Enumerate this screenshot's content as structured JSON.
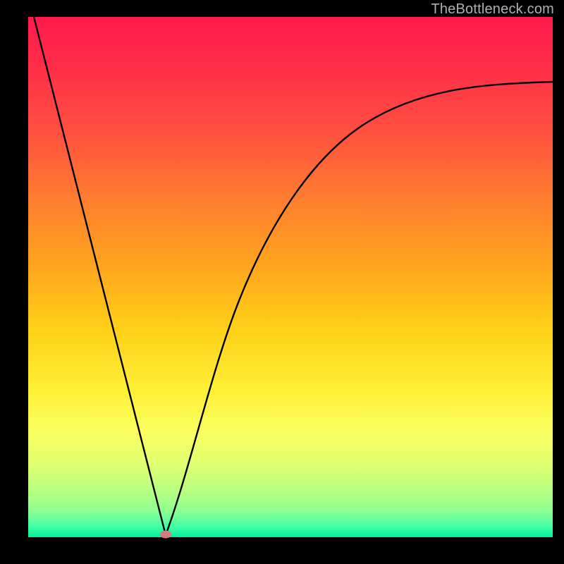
{
  "watermark": "TheBottleneck.com",
  "chart_data": {
    "type": "line",
    "title": "",
    "xlabel": "",
    "ylabel": "",
    "xlim": [
      0,
      100
    ],
    "ylim": [
      0,
      100
    ],
    "grid": false,
    "legend": false,
    "background_gradient": {
      "stops": [
        {
          "pos": 0,
          "color": "#ff1a4d"
        },
        {
          "pos": 50,
          "color": "#ffb81e"
        },
        {
          "pos": 78,
          "color": "#fffb55"
        },
        {
          "pos": 100,
          "color": "#00ef9b"
        }
      ]
    },
    "series": [
      {
        "name": "left-branch",
        "x": [
          1,
          26
        ],
        "y": [
          100,
          0
        ],
        "style": "line"
      },
      {
        "name": "right-branch-curve",
        "x": [
          26,
          30,
          35,
          40,
          45,
          50,
          55,
          60,
          65,
          70,
          75,
          80,
          85,
          90,
          95,
          100
        ],
        "y": [
          0,
          12,
          28,
          41,
          51,
          59,
          66,
          71,
          75,
          78.5,
          81,
          83,
          84.5,
          85.8,
          86.7,
          87.5
        ],
        "style": "curve"
      }
    ],
    "marker": {
      "x": 26,
      "y": 0,
      "color": "#d47c7c"
    }
  },
  "colors": {
    "frame": "#000000",
    "curve": "#000000",
    "marker": "#d47c7c",
    "watermark": "#b0b0b0"
  }
}
